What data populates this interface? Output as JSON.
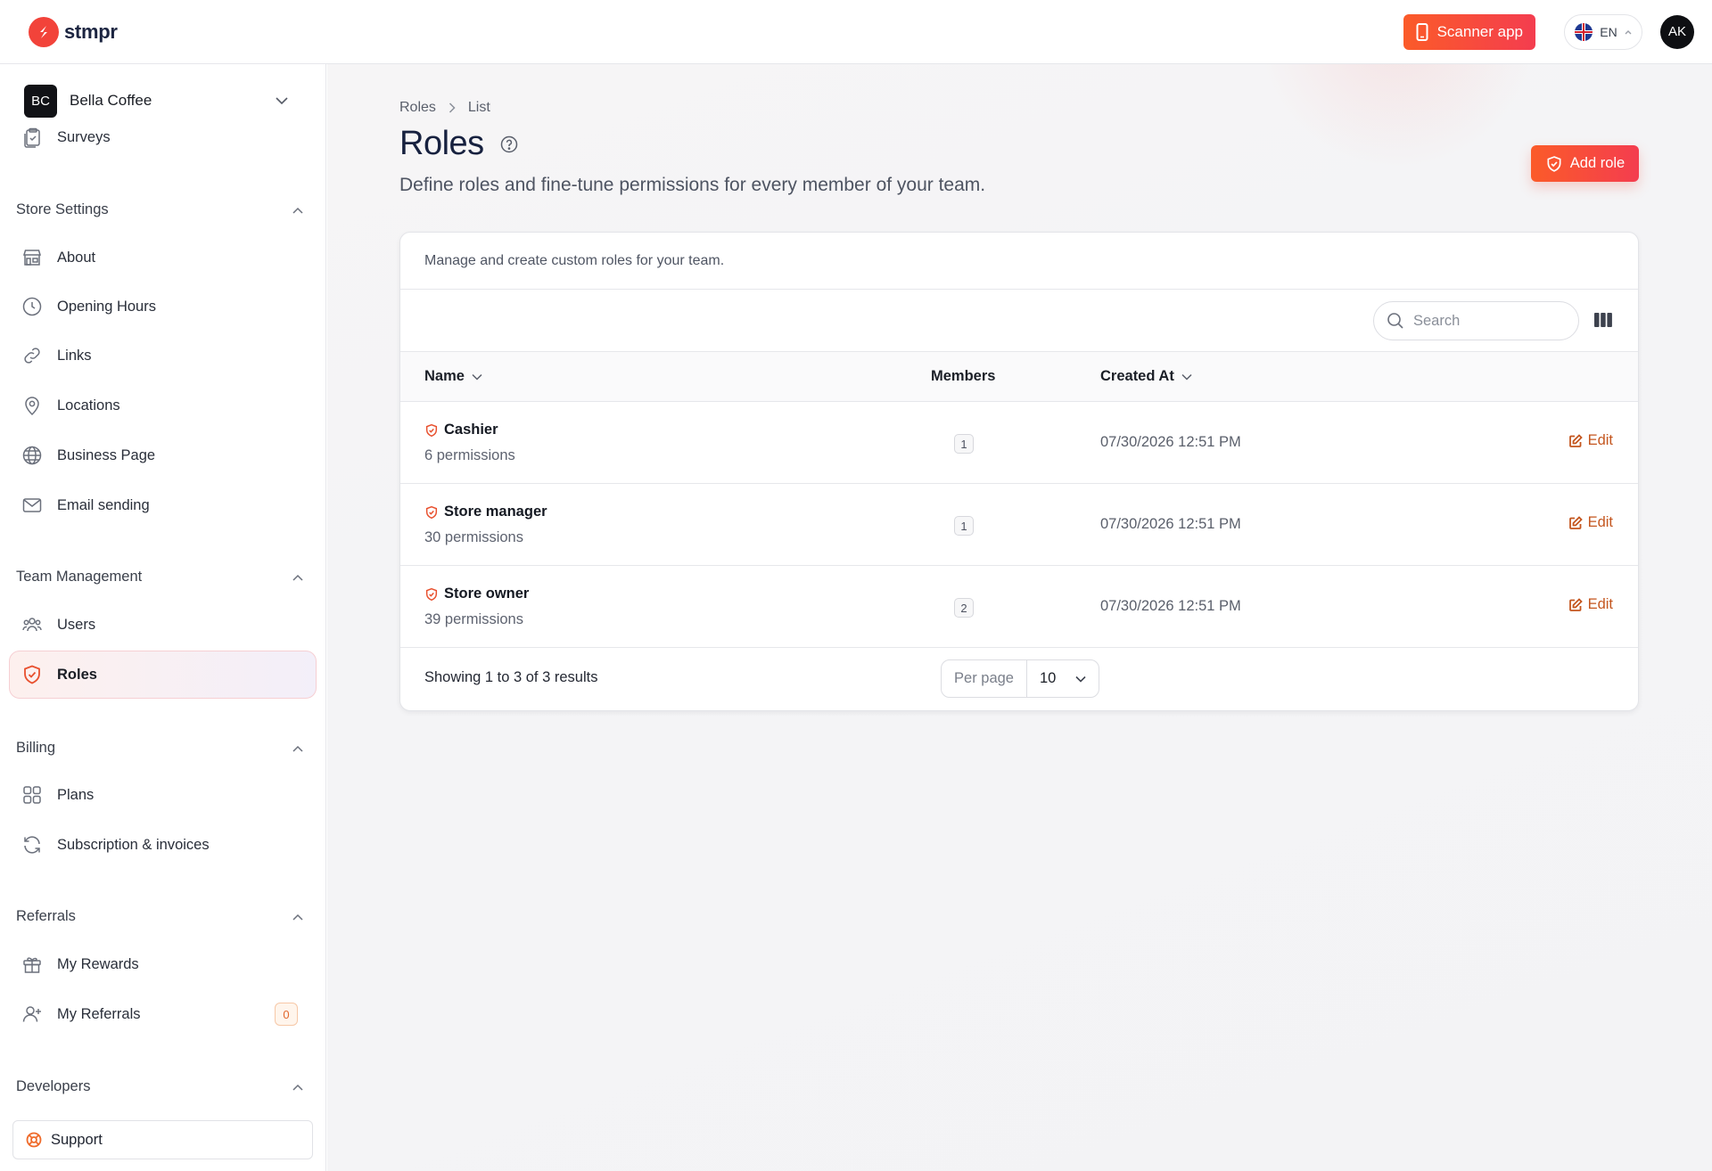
{
  "app": {
    "brand": "stmpr",
    "accent": "#f4433a"
  },
  "topbar": {
    "scanner_label": "Scanner app",
    "language": "EN",
    "avatar_initials": "AK"
  },
  "sidebar": {
    "store": {
      "initials": "BC",
      "name": "Bella Coffee"
    },
    "top_items": [
      {
        "label": "Surveys",
        "icon": "clipboard-icon"
      }
    ],
    "sections": {
      "store_settings": {
        "title": "Store Settings",
        "items": [
          {
            "label": "About",
            "icon": "storefront-icon"
          },
          {
            "label": "Opening Hours",
            "icon": "clock-icon"
          },
          {
            "label": "Links",
            "icon": "link-icon"
          },
          {
            "label": "Locations",
            "icon": "map-pin-icon"
          },
          {
            "label": "Business Page",
            "icon": "globe-icon"
          },
          {
            "label": "Email sending",
            "icon": "envelope-icon"
          }
        ]
      },
      "team_management": {
        "title": "Team Management",
        "items": [
          {
            "label": "Users",
            "icon": "users-icon"
          },
          {
            "label": "Roles",
            "icon": "shield-check-icon",
            "active": true
          }
        ]
      },
      "billing": {
        "title": "Billing",
        "items": [
          {
            "label": "Plans",
            "icon": "grid-icon"
          },
          {
            "label": "Subscription & invoices",
            "icon": "refresh-icon"
          }
        ]
      },
      "referrals": {
        "title": "Referrals",
        "items": [
          {
            "label": "My Rewards",
            "icon": "gift-icon"
          },
          {
            "label": "My Referrals",
            "icon": "user-plus-icon",
            "badge": "0"
          }
        ]
      },
      "developers": {
        "title": "Developers"
      }
    },
    "support_label": "Support"
  },
  "main": {
    "breadcrumb": [
      "Roles",
      "List"
    ],
    "title": "Roles",
    "description": "Define roles and fine-tune permissions for every member of your team.",
    "add_role_label": "Add role",
    "card": {
      "subtitle": "Manage and create custom roles for your team.",
      "search_placeholder": "Search",
      "columns": {
        "name": "Name",
        "members": "Members",
        "created_at": "Created At"
      },
      "rows": [
        {
          "name": "Cashier",
          "permissions": "6 permissions",
          "members": "1",
          "created_at": "07/30/2026 12:51 PM",
          "action": "Edit"
        },
        {
          "name": "Store manager",
          "permissions": "30 permissions",
          "members": "1",
          "created_at": "07/30/2026 12:51 PM",
          "action": "Edit"
        },
        {
          "name": "Store owner",
          "permissions": "39 permissions",
          "members": "2",
          "created_at": "07/30/2026 12:51 PM",
          "action": "Edit"
        }
      ],
      "results_text": "Showing 1 to 3 of 3 results",
      "per_page_label": "Per page",
      "per_page_value": "10"
    }
  }
}
